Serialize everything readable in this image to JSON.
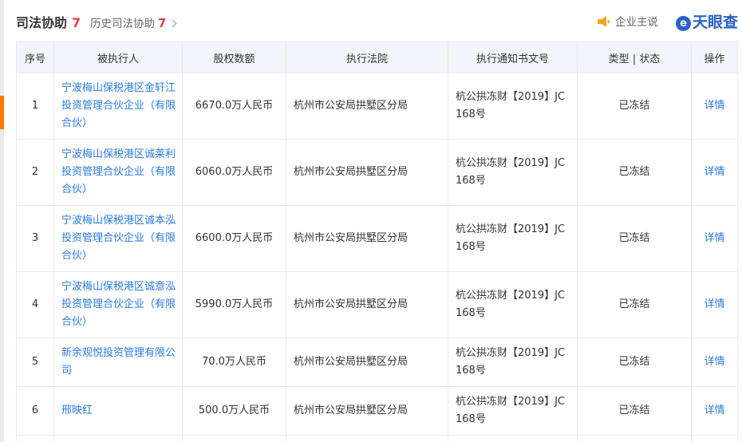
{
  "header": {
    "title": "司法协助",
    "count": "7",
    "history_label": "历史司法协助",
    "history_count": "7",
    "claim_label": "企业主说",
    "brand_name": "天眼查",
    "brand_logo_letter": "e",
    "brand_color": "#2a62c8",
    "accent_color": "#ff7a00"
  },
  "table": {
    "columns": [
      "序号",
      "被执行人",
      "股权数额",
      "执行法院",
      "执行通知书文号",
      "类型 | 状态",
      "操作"
    ],
    "rows": [
      {
        "index": "1",
        "name": "宁波梅山保税港区金轩江投资管理合伙企业（有限合伙）",
        "amount": "6670.0万人民币",
        "court": "杭州市公安局拱墅区分局",
        "doc_no": "杭公拱冻财【2019】JC 168号",
        "status": "已冻结",
        "action": "详情"
      },
      {
        "index": "2",
        "name": "宁波梅山保税港区诚莱利投资管理合伙企业（有限合伙）",
        "amount": "6060.0万人民币",
        "court": "杭州市公安局拱墅区分局",
        "doc_no": "杭公拱冻财【2019】JC 168号",
        "status": "已冻结",
        "action": "详情"
      },
      {
        "index": "3",
        "name": "宁波梅山保税港区诚本泓投资管理合伙企业（有限合伙）",
        "amount": "6600.0万人民币",
        "court": "杭州市公安局拱墅区分局",
        "doc_no": "杭公拱冻财【2019】JC 168号",
        "status": "已冻结",
        "action": "详情"
      },
      {
        "index": "4",
        "name": "宁波梅山保税港区诚意泓投资管理合伙企业（有限合伙）",
        "amount": "5990.0万人民币",
        "court": "杭州市公安局拱墅区分局",
        "doc_no": "杭公拱冻财【2019】JC 168号",
        "status": "已冻结",
        "action": "详情"
      },
      {
        "index": "5",
        "name": "新余观悦投资管理有限公司",
        "amount": "70.0万人民币",
        "court": "杭州市公安局拱墅区分局",
        "doc_no": "杭公拱冻财【2019】JC 168号",
        "status": "已冻结",
        "action": "详情"
      },
      {
        "index": "6",
        "name": "邢映红",
        "amount": "500.0万人民币",
        "court": "杭州市公安局拱墅区分局",
        "doc_no": "杭公拱冻财【2019】JC 168号",
        "status": "已冻结",
        "action": "详情"
      }
    ]
  }
}
